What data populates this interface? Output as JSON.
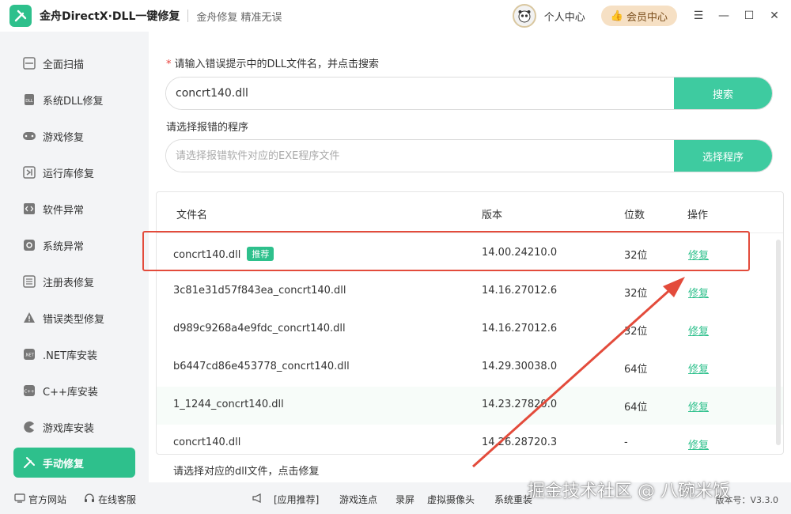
{
  "app": {
    "title": "金舟DirectX·DLL一键修复",
    "slogan": "金舟修复 精准无误",
    "personal_center": "个人中心",
    "vip_center": "会员中心",
    "version": "版本号：V3.3.0"
  },
  "sidebar": {
    "items": [
      {
        "label": "全面扫描",
        "icon": "scan-icon"
      },
      {
        "label": "系统DLL修复",
        "icon": "dll-icon"
      },
      {
        "label": "游戏修复",
        "icon": "gamepad-icon"
      },
      {
        "label": "运行库修复",
        "icon": "vs-icon"
      },
      {
        "label": "软件异常",
        "icon": "code-icon"
      },
      {
        "label": "系统异常",
        "icon": "gear-icon"
      },
      {
        "label": "注册表修复",
        "icon": "list-icon"
      },
      {
        "label": "错误类型修复",
        "icon": "warning-icon"
      },
      {
        "label": ".NET库安装",
        "icon": "dotnet-icon"
      },
      {
        "label": "C++库安装",
        "icon": "cpp-icon"
      },
      {
        "label": "游戏库安装",
        "icon": "pacman-icon"
      },
      {
        "label": "手动修复",
        "icon": "tools-icon",
        "active": true
      }
    ]
  },
  "main": {
    "dll_label": "请输入错误提示中的DLL文件名，并点击搜索",
    "dll_value": "concrt140.dll",
    "search_button": "搜索",
    "program_label": "请选择报错的程序",
    "program_placeholder": "请选择报错软件对应的EXE程序文件",
    "select_button": "选择程序",
    "hint": "请选择对应的dll文件，点击修复"
  },
  "table": {
    "headers": [
      "文件名",
      "版本",
      "位数",
      "操作"
    ],
    "rows": [
      {
        "name": "concrt140.dll",
        "badge": "推荐",
        "version": "14.00.24210.0",
        "bits": "32位",
        "action": "修复"
      },
      {
        "name": "3c81e31d57f843ea_concrt140.dll",
        "version": "14.16.27012.6",
        "bits": "32位",
        "action": "修复"
      },
      {
        "name": "d989c9268a4e9fdc_concrt140.dll",
        "version": "14.16.27012.6",
        "bits": "32位",
        "action": "修复"
      },
      {
        "name": "b6447cd86e453778_concrt140.dll",
        "version": "14.29.30038.0",
        "bits": "64位",
        "action": "修复"
      },
      {
        "name": "1_1244_concrt140.dll",
        "version": "14.23.27820.0",
        "bits": "64位",
        "action": "修复"
      },
      {
        "name": "concrt140.dll",
        "version": "14.26.28720.3",
        "bits": "-",
        "action": "修复"
      }
    ]
  },
  "footer": {
    "website": "官方网站",
    "service": "在线客服",
    "recommend": "[应用推荐]",
    "links": [
      "游戏连点",
      "录屏",
      "虚拟摄像头",
      "系统重装"
    ]
  },
  "watermark": "掘金技术社区 @ 八碗米饭",
  "colors": {
    "accent": "#2ec08c",
    "highlight": "#e34b3b"
  }
}
